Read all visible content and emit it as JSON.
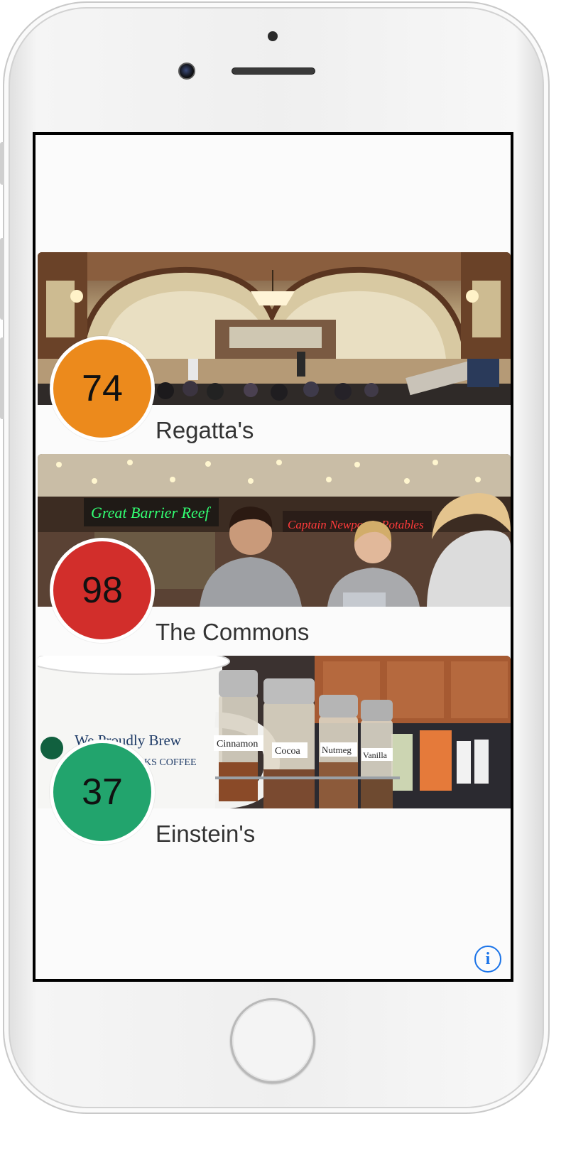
{
  "device": {
    "home_button_icon": "circle-home-button"
  },
  "venues": [
    {
      "name": "Regatta's",
      "score": "74",
      "badge_color": "#ec8a1c",
      "photo": "dining-hall-photo"
    },
    {
      "name": "The Commons",
      "score": "98",
      "badge_color": "#d22e2b",
      "photo": "food-court-students-photo"
    },
    {
      "name": "Einstein's",
      "score": "37",
      "badge_color": "#22a46d",
      "photo": "coffee-shop-spices-photo",
      "photo_labels": {
        "mug_text_1": "We Proudly Brew",
        "mug_text_2": "KS COFFEE",
        "jar_1": "Cinnamon",
        "jar_2": "Cocoa",
        "jar_3": "Nutmeg",
        "jar_4": "Vanilla"
      }
    }
  ],
  "info_button": {
    "icon": "info-icon",
    "glyph": "i",
    "color": "#1a73e8"
  }
}
